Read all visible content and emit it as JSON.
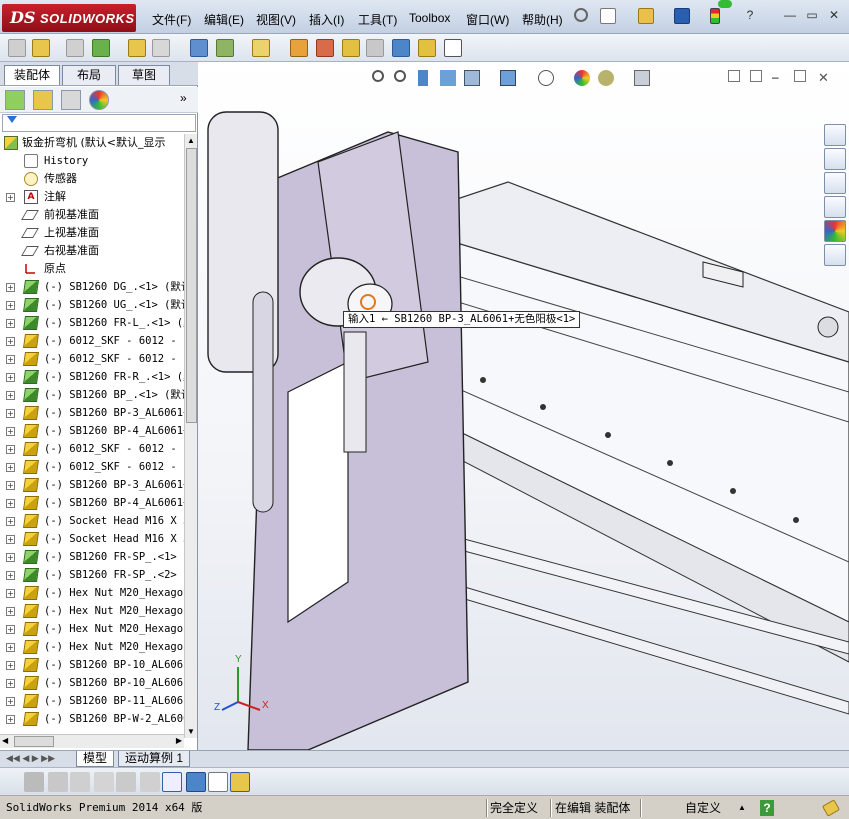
{
  "app": {
    "logo_ds": "DS",
    "logo_text": "SOLIDWORKS"
  },
  "menu": [
    "文件(F)",
    "编辑(E)",
    "视图(V)",
    "插入(I)",
    "工具(T)",
    "Toolbox",
    "窗口(W)",
    "帮助(H)"
  ],
  "window_controls": {
    "help": "?",
    "minimize": "—",
    "restore": "▭",
    "close": "✕"
  },
  "panel_tabs": [
    "装配体",
    "布局",
    "草图"
  ],
  "tree": {
    "root": "钣金折弯机  (默认<默认_显示",
    "items": [
      {
        "label": "History",
        "icon": "history-icon",
        "expand": ""
      },
      {
        "label": "传感器",
        "icon": "sensor-icon",
        "expand": ""
      },
      {
        "label": "注解",
        "icon": "annotation-icon",
        "expand": "+"
      },
      {
        "label": "前视基准面",
        "icon": "plane-icon",
        "expand": ""
      },
      {
        "label": "上视基准面",
        "icon": "plane-icon",
        "expand": ""
      },
      {
        "label": "右视基准面",
        "icon": "plane-icon",
        "expand": ""
      },
      {
        "label": "原点",
        "icon": "origin-icon",
        "expand": ""
      },
      {
        "label": "(-) SB1260 DG_.<1> (默认",
        "icon": "subassembly-icon",
        "expand": "+"
      },
      {
        "label": "(-) SB1260 UG_.<1> (默认",
        "icon": "subassembly-icon",
        "expand": "+"
      },
      {
        "label": "(-) SB1260 FR-L_.<1> (默",
        "icon": "subassembly-icon",
        "expand": "+"
      },
      {
        "label": "(-) 6012_SKF - 6012 - 1",
        "icon": "part-icon",
        "expand": "+"
      },
      {
        "label": "(-) 6012_SKF - 6012 - 1",
        "icon": "part-icon",
        "expand": "+"
      },
      {
        "label": "(-) SB1260 FR-R_.<1> (默",
        "icon": "subassembly-icon",
        "expand": "+"
      },
      {
        "label": "(-) SB1260 BP_.<1> (默认",
        "icon": "subassembly-icon",
        "expand": "+"
      },
      {
        "label": "(-) SB1260 BP-3_AL6061+",
        "icon": "part-icon",
        "expand": "+"
      },
      {
        "label": "(-) SB1260 BP-4_AL6061+",
        "icon": "part-icon",
        "expand": "+"
      },
      {
        "label": "(-) 6012_SKF - 6012 - 1",
        "icon": "part-icon",
        "expand": "+"
      },
      {
        "label": "(-) 6012_SKF - 6012 - 1",
        "icon": "part-icon",
        "expand": "+"
      },
      {
        "label": "(-) SB1260 BP-3_AL6061+",
        "icon": "part-icon",
        "expand": "+"
      },
      {
        "label": "(-) SB1260 BP-4_AL6061+",
        "icon": "part-icon",
        "expand": "+"
      },
      {
        "label": "(-) Socket Head M16 X 3",
        "icon": "part-icon",
        "expand": "+"
      },
      {
        "label": "(-) Socket Head M16 X 3",
        "icon": "part-icon",
        "expand": "+"
      },
      {
        "label": "(-) SB1260 FR-SP_.<1> (",
        "icon": "subassembly-icon",
        "expand": "+"
      },
      {
        "label": "(-) SB1260 FR-SP_.<2> (",
        "icon": "subassembly-icon",
        "expand": "+"
      },
      {
        "label": "(-) Hex Nut M20_Hexagon",
        "icon": "part-icon",
        "expand": "+"
      },
      {
        "label": "(-) Hex Nut M20_Hexagon",
        "icon": "part-icon",
        "expand": "+"
      },
      {
        "label": "(-) Hex Nut M20_Hexagon",
        "icon": "part-icon",
        "expand": "+"
      },
      {
        "label": "(-) Hex Nut M20_Hexagon",
        "icon": "part-icon",
        "expand": "+"
      },
      {
        "label": "(-) SB1260 BP-10_AL6061",
        "icon": "part-icon",
        "expand": "+"
      },
      {
        "label": "(-) SB1260 BP-10_AL6061",
        "icon": "part-icon",
        "expand": "+"
      },
      {
        "label": "(-) SB1260 BP-11_AL6061",
        "icon": "part-icon",
        "expand": "+"
      },
      {
        "label": "(-) SB1260 BP-W-2_AL606",
        "icon": "part-icon",
        "expand": "+"
      }
    ]
  },
  "callout": "输入1 ← SB1260 BP-3_AL6061+无色阳极<1>",
  "bottom_tabs": [
    "模型",
    "运动算例 1"
  ],
  "status": {
    "version": "SolidWorks Premium 2014 x64 版",
    "defined": "完全定义",
    "editing": "在编辑 装配体",
    "units": "自定义",
    "units_arrow": "▲",
    "help": "?"
  },
  "axis_labels": {
    "x": "X",
    "y": "Y",
    "z": "Z"
  }
}
